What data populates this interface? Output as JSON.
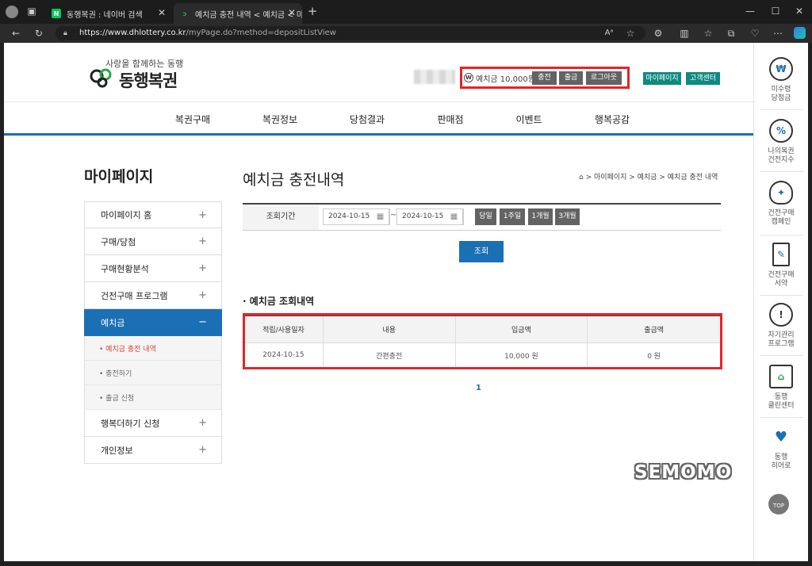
{
  "browser": {
    "tabs": [
      {
        "title": "동행복권 : 네이버 검색",
        "favicon": "N"
      },
      {
        "title": "예치금 충전 내역 < 예치금 < 마이",
        "favicon": "logo"
      }
    ],
    "url_host": "https://www.dhlottery.co.kr",
    "url_path": "/myPage.do?method=depositListView"
  },
  "header": {
    "slogan": "사랑을 함께하는 동행",
    "brand": "동행복권",
    "deposit_label": "예치금 10,000원",
    "charge_btn": "충전",
    "withdraw_btn": "출금",
    "logout_btn": "로그아웃",
    "mypage_btn": "마이페이지",
    "service_btn": "고객센터"
  },
  "nav": [
    "복권구매",
    "복권정보",
    "당첨결과",
    "판매점",
    "이벤트",
    "행복공감"
  ],
  "quick_menu": [
    {
      "label": "미수령\n당첨금",
      "icon": "won-coin-icon"
    },
    {
      "label": "나의복권\n건전지수",
      "icon": "gauge-icon"
    },
    {
      "label": "건전구매\n캠페인",
      "icon": "lightbulb-icon"
    },
    {
      "label": "건전구매\n서약",
      "icon": "pledge-document-icon"
    },
    {
      "label": "자기관리\n프로그램",
      "icon": "alert-icon"
    },
    {
      "label": "동행\n클린센터",
      "icon": "house-plant-icon"
    },
    {
      "label": "동행\n히어로",
      "icon": "winged-heart-icon"
    }
  ],
  "top_btn": "TOP",
  "sidebar": {
    "title": "마이페이지",
    "items": [
      {
        "label": "마이페이지 홈"
      },
      {
        "label": "구매/당첨"
      },
      {
        "label": "구매현황분석"
      },
      {
        "label": "건전구매 프로그램"
      },
      {
        "label": "예치금"
      },
      {
        "label": "행복더하기 신청"
      },
      {
        "label": "개인정보"
      }
    ],
    "sub_items": [
      "• 예치금 충전 내역",
      "• 충전하기",
      "• 출금 신청"
    ]
  },
  "main": {
    "title": "예치금 충전내역",
    "breadcrumb": [
      "마이페이지",
      "예치금",
      "예치금 충전 내역"
    ],
    "search_label": "조회기간",
    "date_from": "2024-10-15",
    "date_to": "2024-10-15",
    "tilde": "~",
    "periods": [
      "당일",
      "1주일",
      "1개월",
      "3개월"
    ],
    "query_btn": "조회",
    "section_title": "· 예치금 조회내역",
    "table": {
      "headers": [
        "적립/사용일자",
        "내용",
        "입금액",
        "출금액"
      ],
      "rows": [
        [
          "2024-10-15",
          "간편충전",
          "10,000 원",
          "0 원"
        ]
      ]
    },
    "page": "1"
  },
  "watermark": "SEMOMO",
  "colors": {
    "primary": "#1b6fb5",
    "teal": "#0f8a80",
    "highlight": "#e3252a"
  }
}
